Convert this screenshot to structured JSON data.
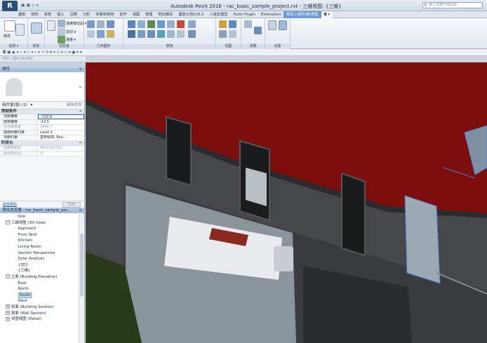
{
  "titlebar": {
    "app_icon": "R",
    "title": "Autodesk Revit 2016 -   rac_basic_sample_project.rvt - 三维视图: {三维}",
    "search_placeholder": "键入关键字或短语"
  },
  "ribbon_tabs": [
    "建筑",
    "结构",
    "系统",
    "插入",
    "注释",
    "分析",
    "体量和场地",
    "协作",
    "视图",
    "管理",
    "附加模块",
    "建筑大师(Ui5.5",
    "八戒去模型",
    "Fuzor Plugin",
    "Extensions",
    "修改 | 组件(窗)类型",
    "◘ ▾"
  ],
  "ribbon": {
    "modify_label": "修改",
    "clipboard_items": [
      "连接端切割 ▾",
      "剪切 ▾",
      "连接 ▾"
    ],
    "panels": [
      "选择 ▾",
      "属性",
      "剪贴板",
      "几何图形",
      "修改",
      "视图",
      "测量",
      "创建"
    ]
  },
  "options_bar": "◘ ▣ ◉ ▾ ◇ ▾ ◇ ▾ ⌕ ▾ ↗ ⚲ A ▾ ⬡ ▾ ◇ ▾ ▣ ▾ ▾",
  "status_line": "修改 | 组件(窗)类型",
  "properties": {
    "title": "属性",
    "type_name": "组件窗(窗) (1)",
    "edit_type": "编辑类型",
    "sections": [
      {
        "name": "限制条件",
        "rows": [
          {
            "k": "顶部偏移",
            "v": "-122.9",
            "state": "edit"
          },
          {
            "k": "底部偏移",
            "v": "-13.5",
            "state": ""
          },
          {
            "k": "无连接高度",
            "v": "2690.7",
            "state": "dim"
          },
          {
            "k": "底部附着约束",
            "v": "Level 2",
            "state": ""
          },
          {
            "k": "顶部约束",
            "v": "直到标高: Roo...",
            "state": ""
          }
        ]
      },
      {
        "name": "阶段化",
        "rows": [
          {
            "k": "创建的阶段",
            "v": "Working Dra...",
            "state": "dim"
          },
          {
            "k": "拆除的阶段",
            "v": "无",
            "state": "dim"
          }
        ]
      }
    ],
    "help_link": "属性帮助",
    "apply_button": "应用"
  },
  "browser": {
    "title": "项目浏览器 - rac_basic_sample_pro...",
    "items": [
      {
        "label": "Site",
        "level": 2,
        "exp": ""
      },
      {
        "label": "三维视图 (3D View)",
        "level": 1,
        "exp": "−"
      },
      {
        "label": "Approach",
        "level": 2,
        "exp": ""
      },
      {
        "label": "From Yard",
        "level": 2,
        "exp": ""
      },
      {
        "label": "Kitchen",
        "level": 2,
        "exp": ""
      },
      {
        "label": "Living Room",
        "level": 2,
        "exp": ""
      },
      {
        "label": "Section Perspective",
        "level": 2,
        "exp": ""
      },
      {
        "label": "Solar Analysis",
        "level": 2,
        "exp": ""
      },
      {
        "label": "{3D}",
        "level": 2,
        "exp": ""
      },
      {
        "label": "{三维}",
        "level": 2,
        "exp": ""
      },
      {
        "label": "立面 (Building Elevation)",
        "level": 1,
        "exp": "−"
      },
      {
        "label": "East",
        "level": 2,
        "exp": ""
      },
      {
        "label": "North",
        "level": 2,
        "exp": ""
      },
      {
        "label": "South",
        "level": 2,
        "exp": "",
        "selected": true
      },
      {
        "label": "West",
        "level": 2,
        "exp": ""
      },
      {
        "label": "剖面 (Building Section)",
        "level": 1,
        "exp": "+"
      },
      {
        "label": "剖面 (Wall Section)",
        "level": 1,
        "exp": "+"
      },
      {
        "label": "详图视图 (Detail)",
        "level": 1,
        "exp": "+"
      }
    ]
  },
  "viewport": {
    "description_icon": "3d-model-icon",
    "colors": {
      "roof": "#7c0e0e",
      "wall": "#46474b",
      "sky": "#0c0c0c",
      "glass": "#9aa3ab",
      "grass": "#2c3a1c",
      "selection": "#4a7fd0"
    }
  }
}
